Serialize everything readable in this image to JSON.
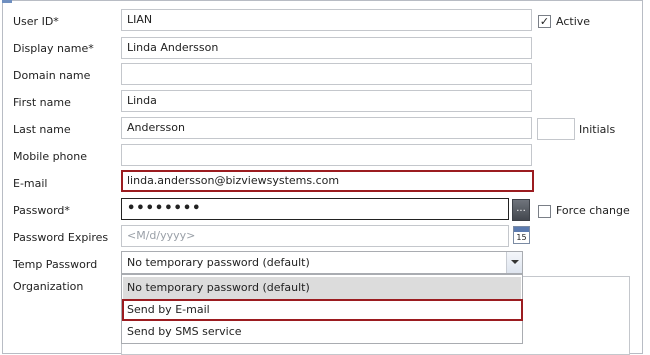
{
  "form": {
    "user_id": {
      "label": "User ID*",
      "value": "LIAN"
    },
    "active": {
      "label": "Active",
      "checked": true
    },
    "display_name": {
      "label": "Display name*",
      "value": "Linda Andersson"
    },
    "domain_name": {
      "label": "Domain name",
      "value": ""
    },
    "first_name": {
      "label": "First name",
      "value": "Linda"
    },
    "last_name": {
      "label": "Last name",
      "value": "Andersson"
    },
    "initials": {
      "label": "Initials",
      "value": ""
    },
    "mobile_phone": {
      "label": "Mobile phone",
      "value": ""
    },
    "email": {
      "label": "E-mail",
      "value": "linda.andersson@bizviewsystems.com"
    },
    "password": {
      "label": "Password*",
      "value": "••••••••",
      "browse_button": "..."
    },
    "force_change": {
      "label": "Force change",
      "checked": false
    },
    "password_expires": {
      "label": "Password Expires",
      "placeholder": "<M/d/yyyy>",
      "calendar_day": "15"
    },
    "temp_password": {
      "label": "Temp Password",
      "selected": "No temporary password (default)",
      "options": [
        "No temporary password (default)",
        "Send by E-mail",
        "Send by SMS service"
      ]
    },
    "organization": {
      "label": "Organization"
    }
  },
  "colors": {
    "focus_border": "#9b1c20",
    "selected_option_bg": "#dcdcdc",
    "field_border": "#c4c7cc"
  }
}
